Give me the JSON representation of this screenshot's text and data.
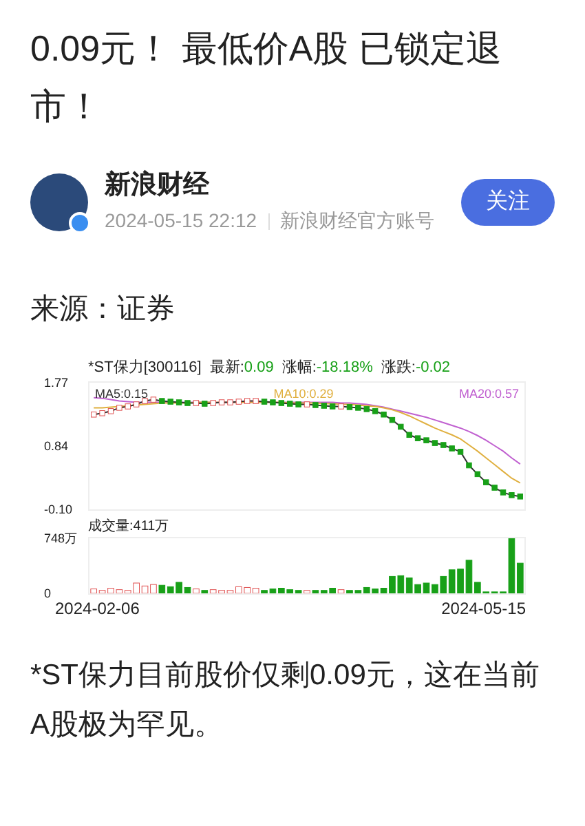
{
  "headline": "0.09元！ 最低价A股 已锁定退市！",
  "author": {
    "name": "新浪财经",
    "time": "2024-05-15 22:12",
    "account": "新浪财经官方账号",
    "verified": true,
    "follow_button": "关注"
  },
  "source": "来源：证券",
  "stock_chart": {
    "symbol": "*ST保力[300116]",
    "latest_label": "最新:",
    "latest": "0.09",
    "change_pct_label": "涨幅:",
    "change_pct": "-18.18%",
    "change_label": "涨跌:",
    "change": "-0.02",
    "chart_data": {
      "type": "line",
      "ylim": [
        -0.1,
        1.77
      ],
      "yticks": [
        {
          "value": 1.77,
          "label": "1.77"
        },
        {
          "value": 0.84,
          "label": "0.84"
        },
        {
          "value": -0.1,
          "label": "-0.10"
        }
      ],
      "series": [
        {
          "name": "MA5:0.15",
          "color": "#333333",
          "marker": "square",
          "values": [
            1.3,
            1.32,
            1.35,
            1.4,
            1.42,
            1.45,
            1.5,
            1.52,
            1.5,
            1.49,
            1.48,
            1.47,
            1.47,
            1.46,
            1.47,
            1.48,
            1.48,
            1.49,
            1.5,
            1.5,
            1.49,
            1.48,
            1.47,
            1.46,
            1.45,
            1.45,
            1.44,
            1.43,
            1.42,
            1.42,
            1.41,
            1.4,
            1.38,
            1.35,
            1.3,
            1.22,
            1.12,
            1.0,
            0.95,
            0.92,
            0.88,
            0.85,
            0.8,
            0.75,
            0.55,
            0.42,
            0.3,
            0.22,
            0.15,
            0.11,
            0.09
          ]
        },
        {
          "name": "MA10:0.29",
          "color": "#e0b040",
          "values": [
            1.4,
            1.4,
            1.41,
            1.42,
            1.43,
            1.44,
            1.45,
            1.46,
            1.47,
            1.47,
            1.47,
            1.47,
            1.48,
            1.48,
            1.48,
            1.48,
            1.48,
            1.48,
            1.48,
            1.48,
            1.48,
            1.48,
            1.48,
            1.47,
            1.47,
            1.47,
            1.47,
            1.46,
            1.46,
            1.45,
            1.45,
            1.44,
            1.43,
            1.42,
            1.4,
            1.37,
            1.33,
            1.28,
            1.22,
            1.16,
            1.1,
            1.05,
            1.0,
            0.94,
            0.85,
            0.76,
            0.66,
            0.56,
            0.46,
            0.36,
            0.29
          ]
        },
        {
          "name": "MA20:0.57",
          "color": "#c060d0",
          "values": [
            1.55,
            1.54,
            1.52,
            1.5,
            1.49,
            1.48,
            1.48,
            1.48,
            1.48,
            1.48,
            1.48,
            1.48,
            1.48,
            1.48,
            1.48,
            1.48,
            1.48,
            1.48,
            1.48,
            1.48,
            1.48,
            1.48,
            1.48,
            1.48,
            1.48,
            1.48,
            1.48,
            1.48,
            1.48,
            1.47,
            1.47,
            1.46,
            1.45,
            1.43,
            1.41,
            1.38,
            1.35,
            1.32,
            1.29,
            1.26,
            1.22,
            1.18,
            1.14,
            1.1,
            1.05,
            0.99,
            0.92,
            0.84,
            0.76,
            0.66,
            0.57
          ]
        }
      ]
    },
    "volume": {
      "label": "成交量:411万",
      "chart_data": {
        "type": "bar",
        "ylim": [
          0,
          748
        ],
        "yticks": [
          {
            "value": 748,
            "label": "748万"
          },
          {
            "value": 0,
            "label": "0"
          }
        ],
        "values": [
          60,
          40,
          70,
          50,
          40,
          140,
          100,
          120,
          110,
          90,
          150,
          80,
          60,
          40,
          50,
          40,
          40,
          90,
          80,
          70,
          40,
          60,
          70,
          50,
          40,
          40,
          40,
          40,
          70,
          50,
          40,
          40,
          80,
          60,
          70,
          230,
          240,
          210,
          120,
          140,
          120,
          230,
          320,
          330,
          450,
          150,
          20,
          20,
          20,
          748,
          410
        ]
      }
    },
    "start_date": "2024-02-06",
    "end_date": "2024-05-15"
  },
  "body": "*ST保力目前股价仅剩0.09元，这在当前A股极为罕见。"
}
